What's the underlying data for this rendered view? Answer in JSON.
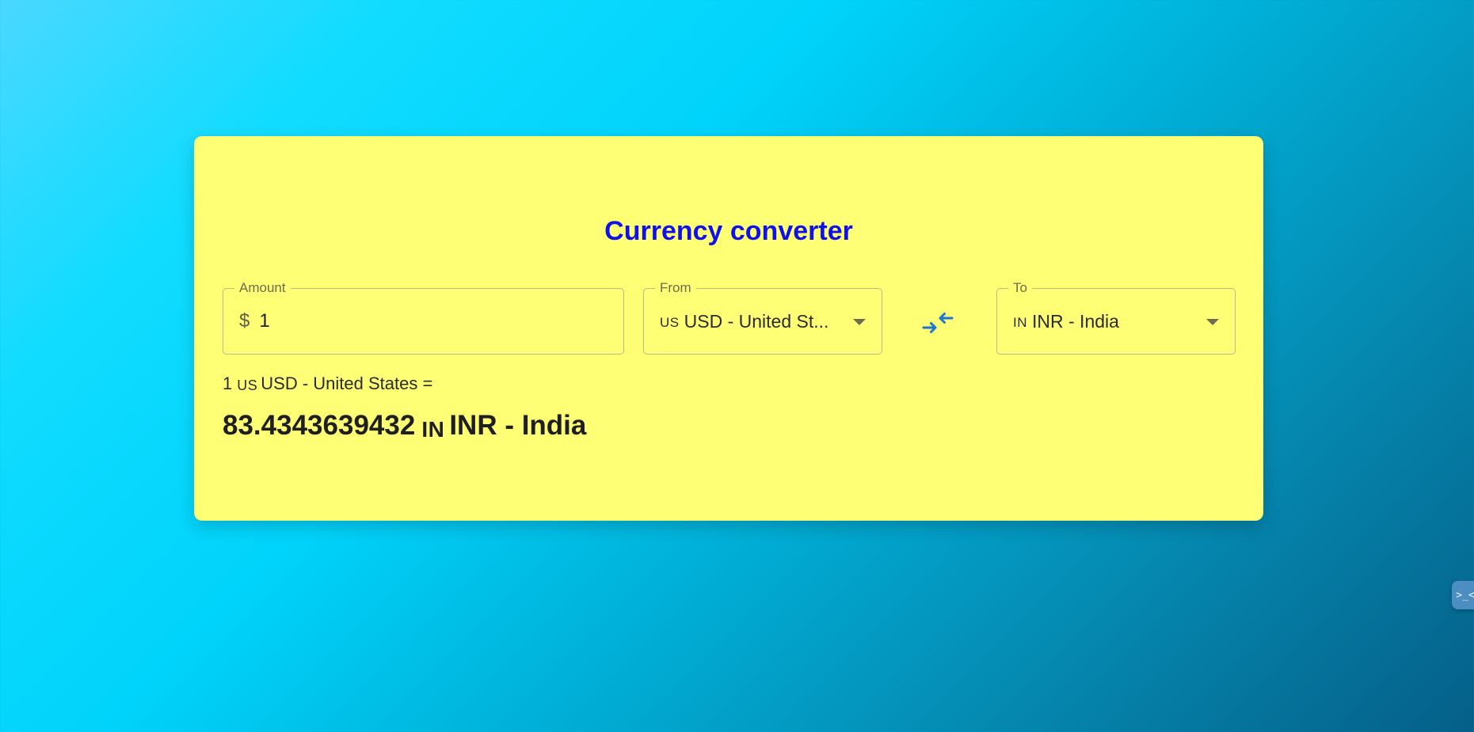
{
  "converter": {
    "title": "Currency converter",
    "amount": {
      "label": "Amount",
      "currency_symbol": "$",
      "value": "1"
    },
    "from": {
      "label": "From",
      "flag": "us",
      "selected": "USD - United St..."
    },
    "to": {
      "label": "To",
      "flag": "in",
      "selected": "INR - India"
    },
    "swap_icon": "swap-arrows-icon",
    "result": {
      "base_amount": "1",
      "base_flag": "us",
      "base_currency": "USD - United States",
      "equals": "=",
      "converted_amount": "83.4343639432",
      "target_flag": "in",
      "target_currency": "INR - India"
    }
  },
  "floating_widget": {
    "icon": "terminal-icon",
    "glyph": ">_<"
  },
  "colors": {
    "card_background": "#ffff75",
    "title_color": "#1010e8",
    "accent_blue": "#1976d2"
  }
}
